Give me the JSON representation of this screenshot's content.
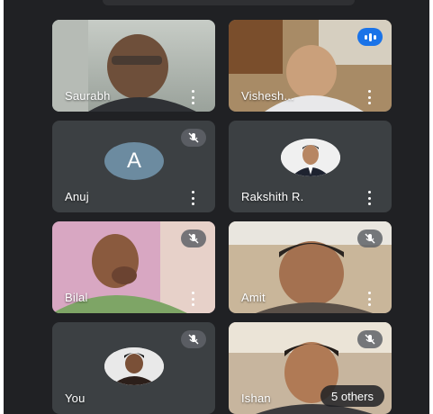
{
  "participants": [
    {
      "name": "Saurabh"
    },
    {
      "name": "Vishesh..."
    },
    {
      "name": "Anuj",
      "avatar_letter": "A"
    },
    {
      "name": "Rakshith R."
    },
    {
      "name": "Bilal"
    },
    {
      "name": "Amit"
    },
    {
      "name": "You"
    },
    {
      "name": "Ishan"
    }
  ],
  "others_chip": "5 others",
  "icons": {
    "more": "more-vert-icon",
    "muted": "mic-off-icon",
    "speaking": "speaking-icon"
  },
  "colors": {
    "background": "#202124",
    "tile": "#3c4043",
    "speaking": "#1a73e8",
    "avatar": "#6c8ba0"
  }
}
